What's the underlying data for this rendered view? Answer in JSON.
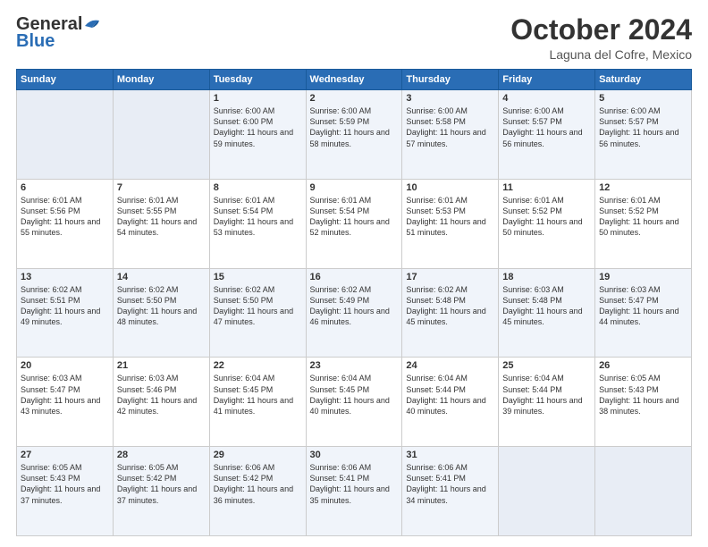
{
  "logo": {
    "general": "General",
    "blue": "Blue",
    "tagline": "GeneralBlue"
  },
  "header": {
    "month": "October 2024",
    "location": "Laguna del Cofre, Mexico"
  },
  "weekdays": [
    "Sunday",
    "Monday",
    "Tuesday",
    "Wednesday",
    "Thursday",
    "Friday",
    "Saturday"
  ],
  "weeks": [
    [
      {
        "day": "",
        "empty": true
      },
      {
        "day": "",
        "empty": true
      },
      {
        "day": "1",
        "sunrise": "Sunrise: 6:00 AM",
        "sunset": "Sunset: 6:00 PM",
        "daylight": "Daylight: 11 hours and 59 minutes."
      },
      {
        "day": "2",
        "sunrise": "Sunrise: 6:00 AM",
        "sunset": "Sunset: 5:59 PM",
        "daylight": "Daylight: 11 hours and 58 minutes."
      },
      {
        "day": "3",
        "sunrise": "Sunrise: 6:00 AM",
        "sunset": "Sunset: 5:58 PM",
        "daylight": "Daylight: 11 hours and 57 minutes."
      },
      {
        "day": "4",
        "sunrise": "Sunrise: 6:00 AM",
        "sunset": "Sunset: 5:57 PM",
        "daylight": "Daylight: 11 hours and 56 minutes."
      },
      {
        "day": "5",
        "sunrise": "Sunrise: 6:00 AM",
        "sunset": "Sunset: 5:57 PM",
        "daylight": "Daylight: 11 hours and 56 minutes."
      }
    ],
    [
      {
        "day": "6",
        "sunrise": "Sunrise: 6:01 AM",
        "sunset": "Sunset: 5:56 PM",
        "daylight": "Daylight: 11 hours and 55 minutes."
      },
      {
        "day": "7",
        "sunrise": "Sunrise: 6:01 AM",
        "sunset": "Sunset: 5:55 PM",
        "daylight": "Daylight: 11 hours and 54 minutes."
      },
      {
        "day": "8",
        "sunrise": "Sunrise: 6:01 AM",
        "sunset": "Sunset: 5:54 PM",
        "daylight": "Daylight: 11 hours and 53 minutes."
      },
      {
        "day": "9",
        "sunrise": "Sunrise: 6:01 AM",
        "sunset": "Sunset: 5:54 PM",
        "daylight": "Daylight: 11 hours and 52 minutes."
      },
      {
        "day": "10",
        "sunrise": "Sunrise: 6:01 AM",
        "sunset": "Sunset: 5:53 PM",
        "daylight": "Daylight: 11 hours and 51 minutes."
      },
      {
        "day": "11",
        "sunrise": "Sunrise: 6:01 AM",
        "sunset": "Sunset: 5:52 PM",
        "daylight": "Daylight: 11 hours and 50 minutes."
      },
      {
        "day": "12",
        "sunrise": "Sunrise: 6:01 AM",
        "sunset": "Sunset: 5:52 PM",
        "daylight": "Daylight: 11 hours and 50 minutes."
      }
    ],
    [
      {
        "day": "13",
        "sunrise": "Sunrise: 6:02 AM",
        "sunset": "Sunset: 5:51 PM",
        "daylight": "Daylight: 11 hours and 49 minutes."
      },
      {
        "day": "14",
        "sunrise": "Sunrise: 6:02 AM",
        "sunset": "Sunset: 5:50 PM",
        "daylight": "Daylight: 11 hours and 48 minutes."
      },
      {
        "day": "15",
        "sunrise": "Sunrise: 6:02 AM",
        "sunset": "Sunset: 5:50 PM",
        "daylight": "Daylight: 11 hours and 47 minutes."
      },
      {
        "day": "16",
        "sunrise": "Sunrise: 6:02 AM",
        "sunset": "Sunset: 5:49 PM",
        "daylight": "Daylight: 11 hours and 46 minutes."
      },
      {
        "day": "17",
        "sunrise": "Sunrise: 6:02 AM",
        "sunset": "Sunset: 5:48 PM",
        "daylight": "Daylight: 11 hours and 45 minutes."
      },
      {
        "day": "18",
        "sunrise": "Sunrise: 6:03 AM",
        "sunset": "Sunset: 5:48 PM",
        "daylight": "Daylight: 11 hours and 45 minutes."
      },
      {
        "day": "19",
        "sunrise": "Sunrise: 6:03 AM",
        "sunset": "Sunset: 5:47 PM",
        "daylight": "Daylight: 11 hours and 44 minutes."
      }
    ],
    [
      {
        "day": "20",
        "sunrise": "Sunrise: 6:03 AM",
        "sunset": "Sunset: 5:47 PM",
        "daylight": "Daylight: 11 hours and 43 minutes."
      },
      {
        "day": "21",
        "sunrise": "Sunrise: 6:03 AM",
        "sunset": "Sunset: 5:46 PM",
        "daylight": "Daylight: 11 hours and 42 minutes."
      },
      {
        "day": "22",
        "sunrise": "Sunrise: 6:04 AM",
        "sunset": "Sunset: 5:45 PM",
        "daylight": "Daylight: 11 hours and 41 minutes."
      },
      {
        "day": "23",
        "sunrise": "Sunrise: 6:04 AM",
        "sunset": "Sunset: 5:45 PM",
        "daylight": "Daylight: 11 hours and 40 minutes."
      },
      {
        "day": "24",
        "sunrise": "Sunrise: 6:04 AM",
        "sunset": "Sunset: 5:44 PM",
        "daylight": "Daylight: 11 hours and 40 minutes."
      },
      {
        "day": "25",
        "sunrise": "Sunrise: 6:04 AM",
        "sunset": "Sunset: 5:44 PM",
        "daylight": "Daylight: 11 hours and 39 minutes."
      },
      {
        "day": "26",
        "sunrise": "Sunrise: 6:05 AM",
        "sunset": "Sunset: 5:43 PM",
        "daylight": "Daylight: 11 hours and 38 minutes."
      }
    ],
    [
      {
        "day": "27",
        "sunrise": "Sunrise: 6:05 AM",
        "sunset": "Sunset: 5:43 PM",
        "daylight": "Daylight: 11 hours and 37 minutes."
      },
      {
        "day": "28",
        "sunrise": "Sunrise: 6:05 AM",
        "sunset": "Sunset: 5:42 PM",
        "daylight": "Daylight: 11 hours and 37 minutes."
      },
      {
        "day": "29",
        "sunrise": "Sunrise: 6:06 AM",
        "sunset": "Sunset: 5:42 PM",
        "daylight": "Daylight: 11 hours and 36 minutes."
      },
      {
        "day": "30",
        "sunrise": "Sunrise: 6:06 AM",
        "sunset": "Sunset: 5:41 PM",
        "daylight": "Daylight: 11 hours and 35 minutes."
      },
      {
        "day": "31",
        "sunrise": "Sunrise: 6:06 AM",
        "sunset": "Sunset: 5:41 PM",
        "daylight": "Daylight: 11 hours and 34 minutes."
      },
      {
        "day": "",
        "empty": true
      },
      {
        "day": "",
        "empty": true
      }
    ]
  ]
}
